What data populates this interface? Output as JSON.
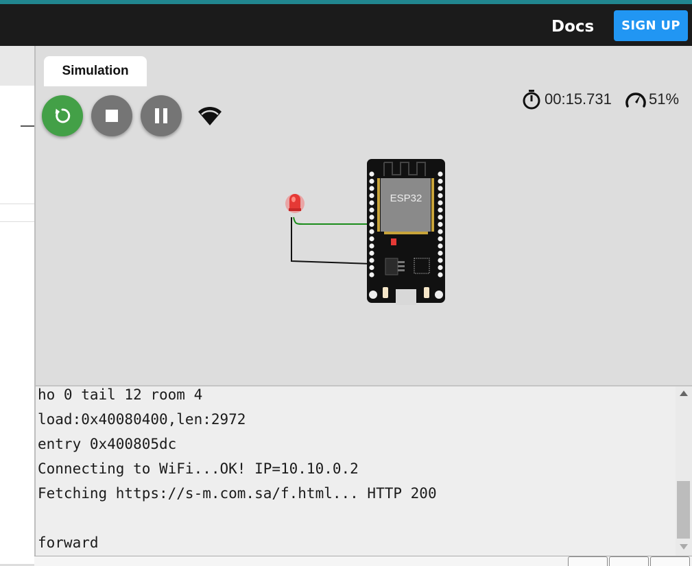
{
  "header": {
    "docs_label": "Docs",
    "signup_label": "SIGN UP",
    "brand_color": "#2196f3"
  },
  "simulation": {
    "tab_label": "Simulation",
    "controls": [
      {
        "name": "restart",
        "icon": "restart-icon",
        "color": "#43a047"
      },
      {
        "name": "stop",
        "icon": "stop-icon",
        "color": "#757575"
      },
      {
        "name": "pause",
        "icon": "pause-icon",
        "color": "#757575"
      }
    ],
    "wifi_icon": "wifi-icon",
    "timer": "00:15.731",
    "speed": "51%"
  },
  "circuit": {
    "board_label": "ESP32",
    "led_color": "red",
    "wires": [
      "green",
      "black"
    ]
  },
  "serial_monitor": {
    "lines": [
      "ho 0 tail 12 room 4",
      "load:0x40080400,len:2972",
      "entry 0x400805dc",
      "Connecting to WiFi...OK! IP=10.10.0.2",
      "Fetching https://s-m.com.sa/f.html... HTTP 200",
      "",
      "forward"
    ]
  }
}
